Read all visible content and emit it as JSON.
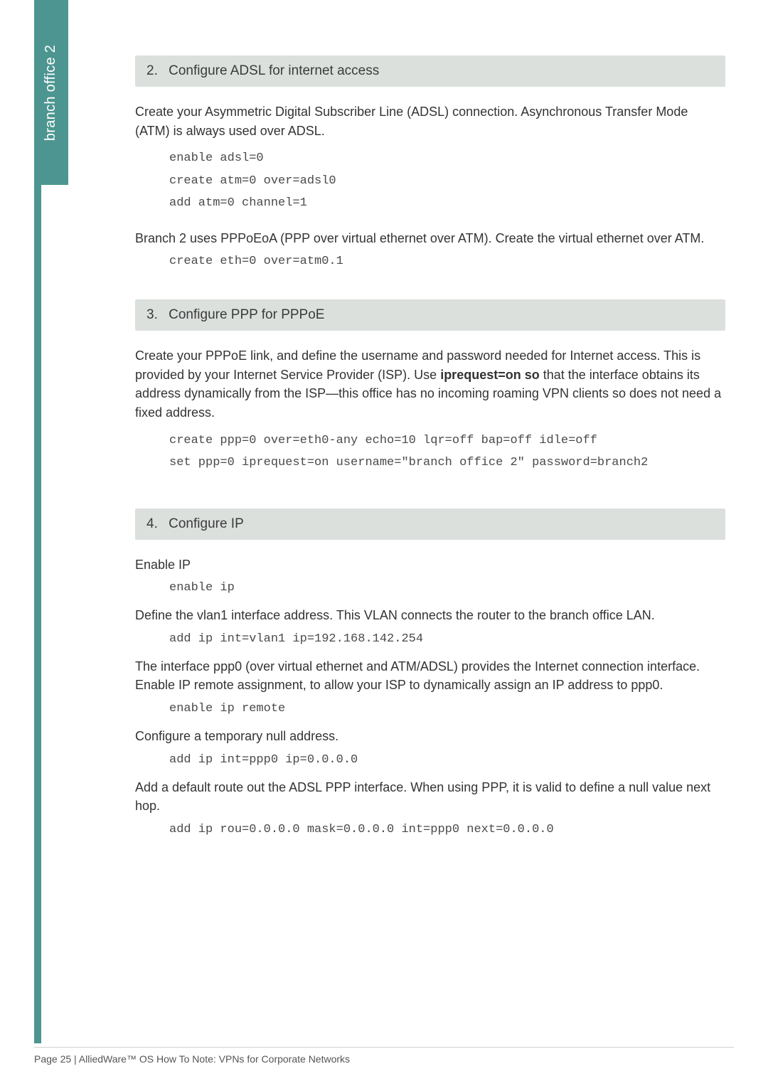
{
  "side_tab": "branch office 2",
  "sections": {
    "s2": {
      "num": "2.",
      "title": "Configure ADSL for internet access",
      "p1a": "Create your Asymmetric Digital Subscriber Line (ADSL) connection. Asynchronous Transfer Mode (ATM) is always used over ADSL.",
      "code1": "enable adsl=0\ncreate atm=0 over=adsl0\nadd atm=0 channel=1",
      "p2": "Branch 2 uses PPPoEoA (PPP over virtual ethernet over ATM). Create the virtual ethernet over ATM.",
      "code2": "create eth=0 over=atm0.1"
    },
    "s3": {
      "num": "3.",
      "title": "Configure PPP for PPPoE",
      "p1_before": "Create your PPPoE link, and define the username and password needed for Internet access. This is provided by your Internet Service Provider (ISP). Use ",
      "p1_bold": "iprequest=on so",
      "p1_after": " that the interface obtains its address dynamically from the ISP—this office has no incoming roaming VPN clients so does not need a fixed address.",
      "code1": "create ppp=0 over=eth0-any echo=10 lqr=off bap=off idle=off\nset ppp=0 iprequest=on username=\"branch office 2\" password=branch2"
    },
    "s4": {
      "num": "4.",
      "title": "Configure IP",
      "p1": "Enable IP",
      "code1": "enable ip",
      "p2": "Define the vlan1 interface address. This VLAN connects the router to the branch office LAN.",
      "code2": "add ip int=vlan1 ip=192.168.142.254",
      "p3": "The interface ppp0 (over virtual ethernet and ATM/ADSL) provides the Internet connection interface. Enable IP remote assignment, to allow your ISP to dynamically assign an IP address to ppp0.",
      "code3": "enable ip remote",
      "p4": "Configure a temporary null address.",
      "code4": "add ip int=ppp0 ip=0.0.0.0",
      "p5": "Add a default route out the ADSL PPP interface. When using PPP, it is valid to define a null value next hop.",
      "code5": "add ip rou=0.0.0.0 mask=0.0.0.0 int=ppp0 next=0.0.0.0"
    }
  },
  "footer": "Page 25 | AlliedWare™ OS How To Note: VPNs for Corporate Networks"
}
